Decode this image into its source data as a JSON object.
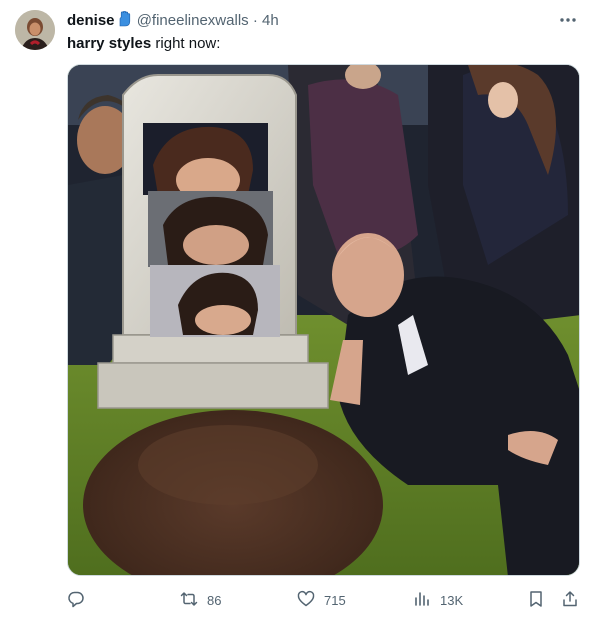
{
  "tweet": {
    "author": {
      "display_name": "denise",
      "handle": "@fineelinexwalls",
      "separator": "·",
      "time": "4h",
      "verified_icon": "blue-hand-emoji"
    },
    "text": {
      "bold": "harry styles",
      "rest": " right now:"
    },
    "media": {
      "kind": "meme-photo"
    },
    "actions": {
      "reply_icon": "reply-icon",
      "retweet_count": "86",
      "like_count": "715",
      "views_count": "13K",
      "bookmark_icon": "bookmark-icon",
      "share_icon": "share-icon"
    },
    "colors": {
      "text": "#0f1419",
      "secondary": "#536471",
      "border": "#cfd9de",
      "verified": "#1d9bf0"
    }
  }
}
